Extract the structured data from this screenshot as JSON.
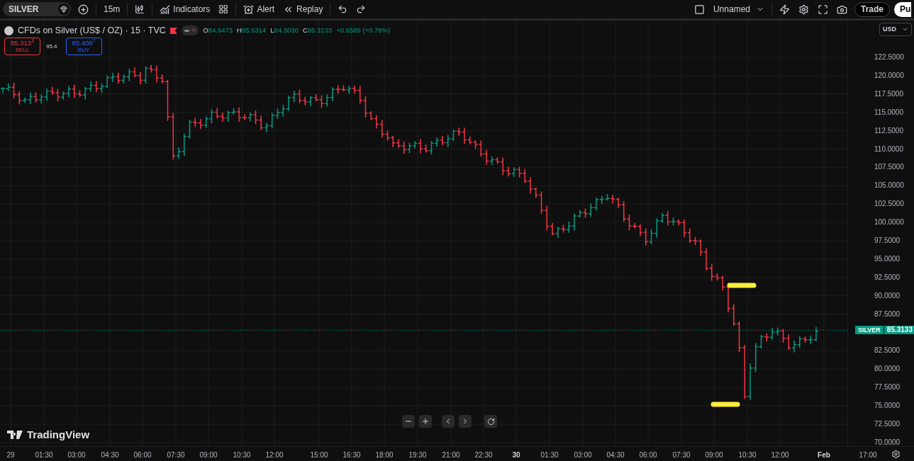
{
  "toolbar": {
    "symbol": "SILVER",
    "interval": "15m",
    "buttons": [
      {
        "kind": "indicators",
        "label": "Indicators"
      },
      {
        "kind": "alert",
        "label": "Alert"
      },
      {
        "kind": "replay",
        "label": "Replay"
      }
    ],
    "layout_name": "Unnamed",
    "trade": "Trade",
    "publish": "Pu"
  },
  "legend": {
    "title": "CFDs on Silver (US$ / OZ) · 15 · TVC",
    "ohlc": [
      {
        "label": "O",
        "value": "84.6473"
      },
      {
        "label": "H",
        "value": "85.6314"
      },
      {
        "label": "L",
        "value": "84.3030"
      },
      {
        "label": "C",
        "value": "85.3133"
      }
    ],
    "change": "+0.6589 (+0.78%)",
    "status_symbol": "≈"
  },
  "trade_panel": {
    "sell": {
      "price": "85.313$^{3}$",
      "label": "SELL"
    },
    "spread": "95.4",
    "buy": {
      "price": "85.408$^{7}$",
      "label": "BUY"
    }
  },
  "currency": "USD",
  "price_axis": [
    "122.5000",
    "120.0000",
    "117.5000",
    "115.0000",
    "112.5000",
    "110.0000",
    "107.5000",
    "105.0000",
    "102.5000",
    "100.0000",
    "97.5000",
    "95.0000",
    "92.5000",
    "90.0000",
    "87.5000",
    "82.5000",
    "80.0000",
    "77.5000",
    "75.0000",
    "72.5000",
    "70.0000"
  ],
  "last_price": {
    "symbol": "SILVER",
    "price": "85.3133"
  },
  "time_axis": [
    "29",
    "01:30",
    "03:00",
    "04:30",
    "06:00",
    "07:30",
    "09:00",
    "10:30",
    "12:00",
    "15:00",
    "16:30",
    "18:00",
    "19:30",
    "21:00",
    "22:30",
    "30",
    "01:30",
    "03:00",
    "04:30",
    "06:00",
    "07:30",
    "09:00",
    "10:30",
    "12:00",
    "Feb",
    "17:00"
  ],
  "watermark": "TradingView"
}
